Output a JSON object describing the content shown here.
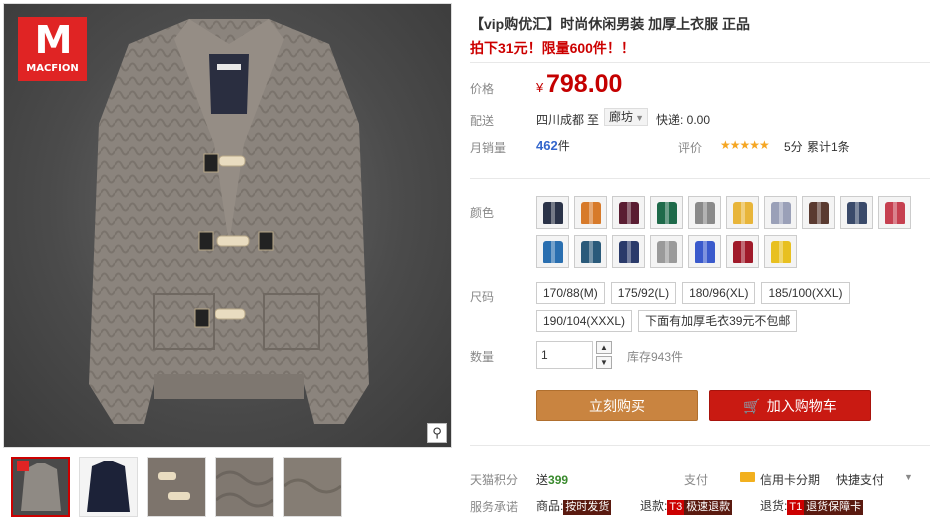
{
  "gallery": {
    "logo_brand": "MACFION",
    "zoom_icon": "magnifier-icon",
    "thumbnails": [
      {
        "color": "#8f8a84",
        "selected": true
      },
      {
        "color": "#1c2238",
        "selected": false
      },
      {
        "color": "#7d746c",
        "selected": false
      },
      {
        "color": "#807870",
        "selected": false
      },
      {
        "color": "#857d74",
        "selected": false
      }
    ]
  },
  "product": {
    "title": "【vip购优汇】时尚休闲男装 加厚上衣服 正品",
    "promo": "拍下31元！限量600件！！",
    "price_label": "价格",
    "currency": "¥",
    "price": "798.00",
    "shipping_label": "配送",
    "ship_from": "四川成都",
    "ship_to_word": "至",
    "ship_to": "廊坊",
    "express": "快递: 0.00",
    "monthly_sales_label": "月销量",
    "monthly_sales": "462",
    "monthly_sales_unit": "件",
    "rating_label": "评价",
    "rating_stars": "★★★★★",
    "rating_score": "5分",
    "review_count": "累计1条"
  },
  "options": {
    "color_label": "颜色",
    "colors": [
      "#2b3348",
      "#d77a2a",
      "#5a1d32",
      "#1e6a4a",
      "#8a8a8a",
      "#e8b53a",
      "#9aa0b8",
      "#5a3a30",
      "#3a4a6a",
      "#c64050",
      "#2a6fb0",
      "#2a5a7a",
      "#2a3a6a",
      "#9a9a9a",
      "#3a5acc",
      "#a01a2a",
      "#e8c020"
    ],
    "size_label": "尺码",
    "sizes": [
      "170/88(M)",
      "175/92(L)",
      "180/96(XL)",
      "185/100(XXL)",
      "190/104(XXXL)",
      "下面有加厚毛衣39元不包邮"
    ],
    "qty_label": "数量",
    "qty_value": "1",
    "stock": "库存943件"
  },
  "actions": {
    "buy_now": "立刻购买",
    "add_to_cart": "加入购物车"
  },
  "footer": {
    "points_label": "天猫积分",
    "points_prefix": "送",
    "points_value": "399",
    "pay_label": "支付",
    "credit_card": "信用卡分期",
    "quick_pay": "快捷支付",
    "service_label": "服务承诺",
    "goods_label": "商品:",
    "goods_tag": "按时发货",
    "refund_label": "退款:",
    "refund_tag_prefix": "T3",
    "refund_tag": "极速退款",
    "return_label": "退货:",
    "return_tag_prefix": "T1",
    "return_tag": "退货保障卡"
  }
}
